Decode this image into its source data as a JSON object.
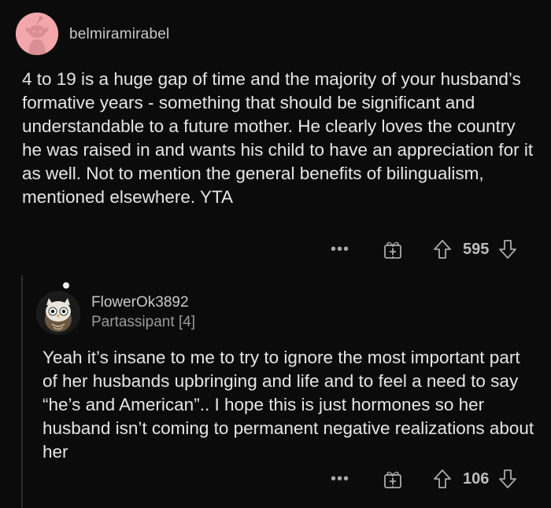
{
  "comment": {
    "username": "belmiramirabel",
    "body": "4 to 19 is a huge gap of time and the majority of your husband’s formative years - something that should be significant and understandable to a future mother. He clearly loves the country he was raised in and wants his child to have an appreciation for it as well. Not to mention the general benefits of bilingualism, mentioned elsewhere. YTA",
    "more_label": "•••",
    "score": "595",
    "avatar_color": "#f4a7ab"
  },
  "reply": {
    "username": "FlowerOk3892",
    "flair": "Partassipant [4]",
    "body": "Yeah it’s insane to me to try to ignore the most important part of her husbands upbringing and life and to feel a need to say “he’s and American”.. I hope this is just hormones so her husband isn’t coming to permanent negative realizations about her",
    "more_label": "•••",
    "score": "106"
  },
  "icons": {
    "award": "gift-award-icon",
    "upvote": "arrow-up-icon",
    "downvote": "arrow-down-icon",
    "more": "more-dots-icon"
  }
}
